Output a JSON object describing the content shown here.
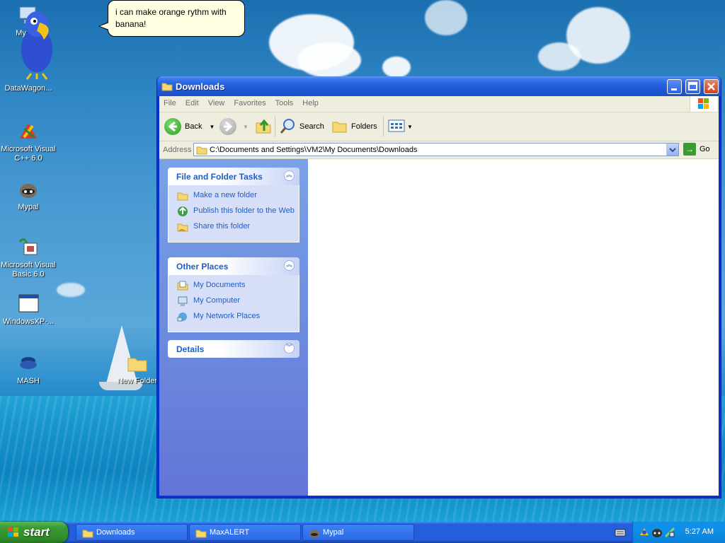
{
  "desktop": {
    "agent_speech": "i can make orange rythm with banana!",
    "icons": [
      {
        "label": "My Cor"
      },
      {
        "label": "DataWagon..."
      },
      {
        "label": "Microsoft Visual C++ 6.0"
      },
      {
        "label": "Mypal"
      },
      {
        "label": "Microsoft Visual Basic 6.0"
      },
      {
        "label": "WindowsXP-..."
      },
      {
        "label": "MASH"
      },
      {
        "label": "New Folder"
      }
    ]
  },
  "window": {
    "title": "Downloads",
    "menu": [
      "File",
      "Edit",
      "View",
      "Favorites",
      "Tools",
      "Help"
    ],
    "toolbar": {
      "back": "Back",
      "search": "Search",
      "folders": "Folders"
    },
    "address": {
      "label": "Address",
      "path": "C:\\Documents and Settings\\VM2\\My Documents\\Downloads",
      "go": "Go"
    },
    "taskpane": {
      "file_tasks": {
        "title": "File and Folder Tasks",
        "items": [
          "Make a new folder",
          "Publish this folder to the Web",
          "Share this folder"
        ]
      },
      "other_places": {
        "title": "Other Places",
        "items": [
          "My Documents",
          "My Computer",
          "My Network Places"
        ]
      },
      "details": {
        "title": "Details"
      }
    }
  },
  "taskbar": {
    "start": "start",
    "tasks": [
      "Downloads",
      "MaxALERT",
      "Mypal"
    ],
    "clock": "5:27 AM"
  }
}
